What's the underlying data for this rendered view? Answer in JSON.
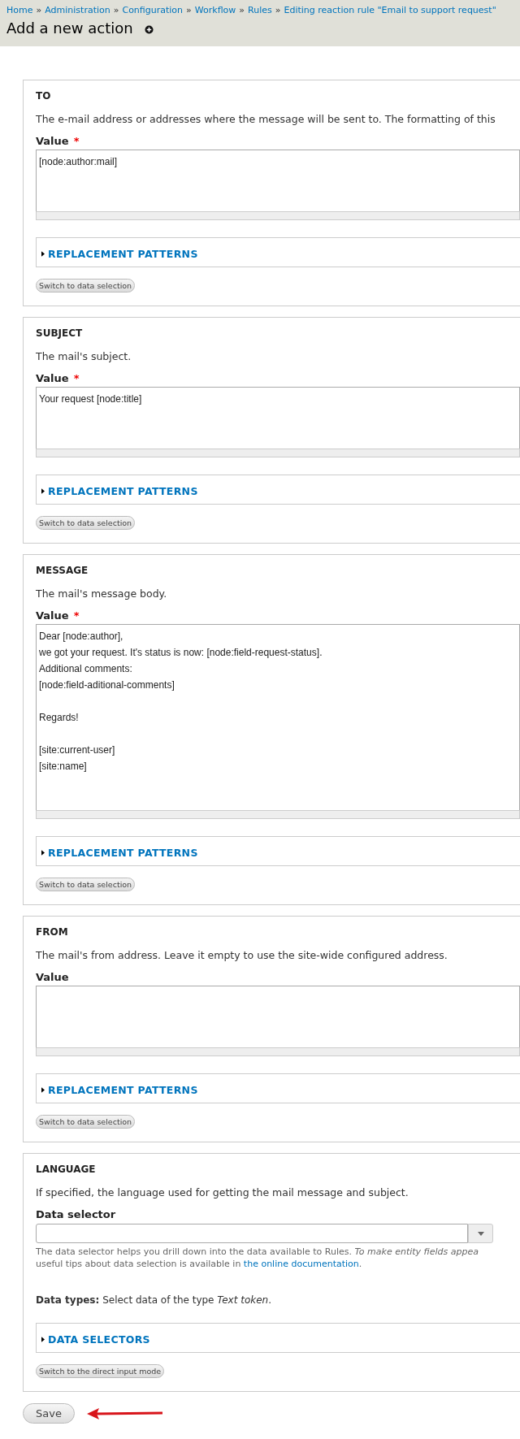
{
  "breadcrumb": [
    "Home",
    "Administration",
    "Configuration",
    "Workflow",
    "Rules",
    "Editing reaction rule \"Email to support request\""
  ],
  "breadcrumb_separator": "»",
  "page_title": "Add a new action",
  "sections": [
    {
      "kind": "text",
      "heading": "TO",
      "description": "The e-mail address or addresses where the message will be sent to. The formatting of this",
      "value_label": "Value",
      "required_mark": "*",
      "value": "[node:author:mail]",
      "patterns_label": "REPLACEMENT PATTERNS",
      "switch_button": "Switch to data selection"
    },
    {
      "kind": "text",
      "heading": "SUBJECT",
      "description": "The mail's subject.",
      "value_label": "Value",
      "required_mark": "*",
      "value": "Your request [node:title]",
      "patterns_label": "REPLACEMENT PATTERNS",
      "switch_button": "Switch to data selection"
    },
    {
      "kind": "text",
      "heading": "MESSAGE",
      "description": "The mail's message body.",
      "value_label": "Value",
      "required_mark": "*",
      "value": "Dear [node:author],\nwe got your request. It's status is now: [node:field-request-status].\nAdditional comments:\n[node:field-aditional-comments]\n\nRegards!\n\n[site:current-user]\n[site:name]",
      "patterns_label": "REPLACEMENT PATTERNS",
      "switch_button": "Switch to data selection"
    },
    {
      "kind": "text",
      "heading": "FROM",
      "description": "The mail's from address. Leave it empty to use the site-wide configured address.",
      "value_label": "Value",
      "patterns_label": "REPLACEMENT PATTERNS",
      "switch_button": "Switch to data selection"
    },
    {
      "kind": "selector",
      "heading": "LANGUAGE",
      "description": "If specified, the language used for getting the mail message and subject.",
      "value_label": "Data selector",
      "hint_line_1": "The data selector helps you drill down into the data available to Rules. *To make entity fields appea*",
      "hint_line_2": "useful tips about data selection is available in",
      "hint_link": "the online documentation",
      "hint_end": ".",
      "data_types": "**Data types:** Select data of the type *Text token*.",
      "patterns_label": "DATA SELECTORS",
      "switch_button": "Switch to the direct input mode"
    }
  ],
  "save_button": "Save"
}
